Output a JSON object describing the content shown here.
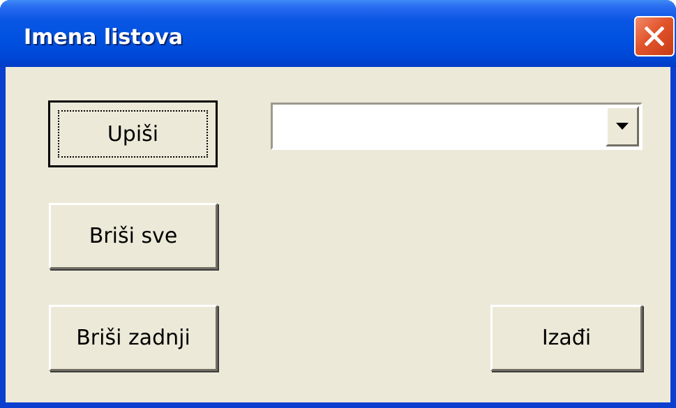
{
  "window": {
    "title": "Imena listova"
  },
  "icons": {
    "close": "close-icon",
    "dropdown": "dropdown-arrow-icon"
  },
  "colors": {
    "titlebar": "#0055e5",
    "close_button": "#e2552c",
    "dialog_face": "#ece9d8"
  },
  "buttons": {
    "upisi": "Upiši",
    "brisi_sve": "Briši sve",
    "brisi_zadnji": "Briši zadnji",
    "izadi": "Izađi"
  },
  "combo": {
    "value": ""
  }
}
